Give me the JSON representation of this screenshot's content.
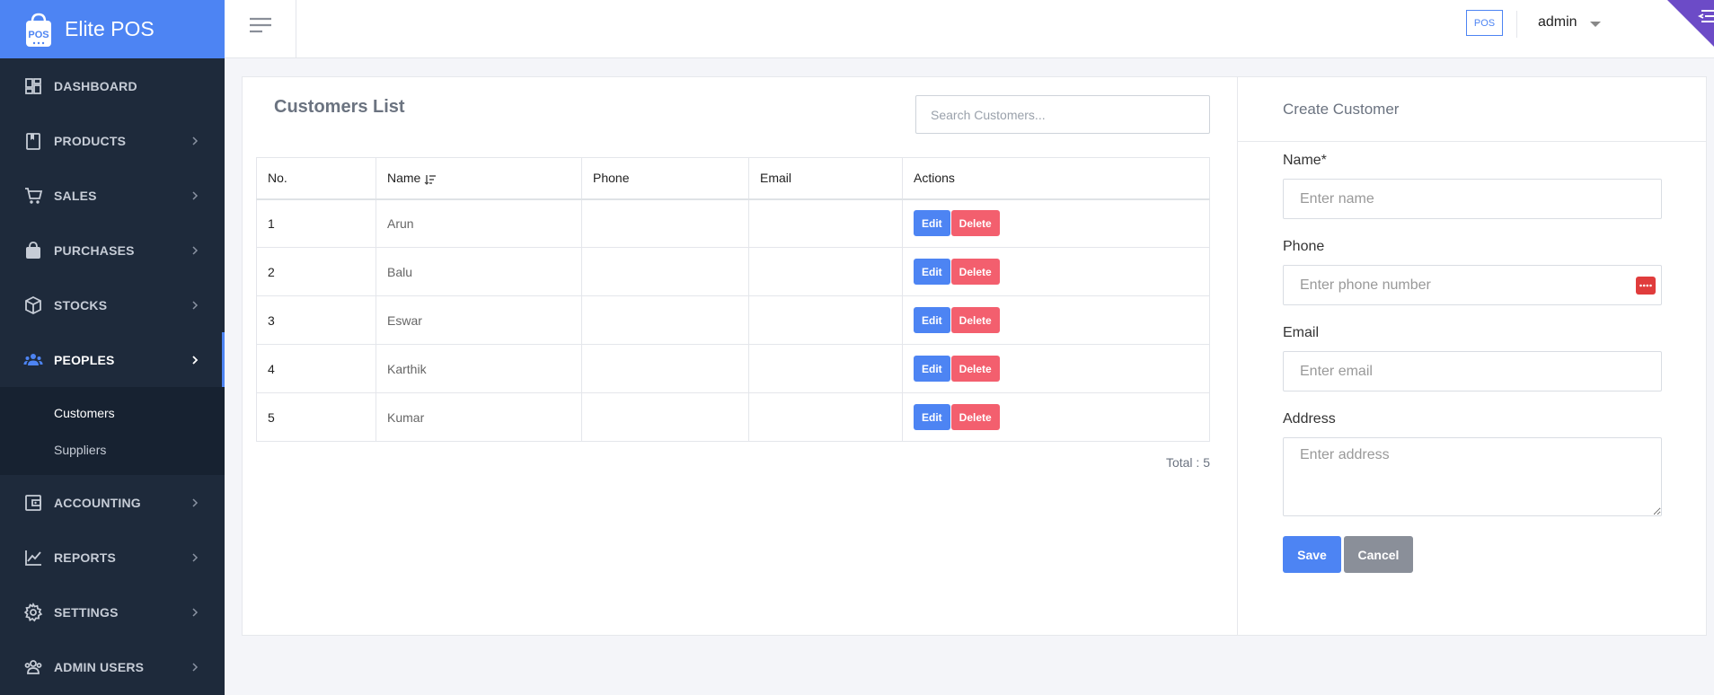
{
  "app": {
    "title": "Elite POS"
  },
  "sidebar": {
    "items": [
      {
        "label": "DASHBOARD",
        "icon": "dashboard-icon"
      },
      {
        "label": "PRODUCTS",
        "icon": "book-icon"
      },
      {
        "label": "SALES",
        "icon": "cart-icon"
      },
      {
        "label": "PURCHASES",
        "icon": "shopping-bag-icon"
      },
      {
        "label": "STOCKS",
        "icon": "box-icon"
      },
      {
        "label": "PEOPLES",
        "icon": "people-icon"
      },
      {
        "label": "ACCOUNTING",
        "icon": "wallet-icon"
      },
      {
        "label": "REPORTS",
        "icon": "chart-line-icon"
      },
      {
        "label": "SETTINGS",
        "icon": "gear-icon"
      },
      {
        "label": "ADMIN USERS",
        "icon": "admin-users-icon"
      }
    ],
    "active": "PEOPLES",
    "subitems": [
      {
        "label": "Customers"
      },
      {
        "label": "Suppliers"
      }
    ]
  },
  "topbar": {
    "pos_label": "POS",
    "user": "admin"
  },
  "customers": {
    "title": "Customers List",
    "search_placeholder": "Search Customers...",
    "columns": [
      "No.",
      "Name",
      "Phone",
      "Email",
      "Actions"
    ],
    "rows": [
      {
        "no": "1",
        "name": "Arun",
        "phone": "",
        "email": ""
      },
      {
        "no": "2",
        "name": "Balu",
        "phone": "",
        "email": ""
      },
      {
        "no": "3",
        "name": "Eswar",
        "phone": "",
        "email": ""
      },
      {
        "no": "4",
        "name": "Karthik",
        "phone": "",
        "email": ""
      },
      {
        "no": "5",
        "name": "Kumar",
        "phone": "",
        "email": ""
      }
    ],
    "edit_label": "Edit",
    "delete_label": "Delete",
    "total": "Total : 5"
  },
  "create": {
    "title": "Create Customer",
    "name_label": "Name*",
    "name_placeholder": "Enter name",
    "phone_label": "Phone",
    "phone_placeholder": "Enter phone number",
    "email_label": "Email",
    "email_placeholder": "Enter email",
    "address_label": "Address",
    "address_placeholder": "Enter address",
    "save_label": "Save",
    "cancel_label": "Cancel"
  },
  "colors": {
    "brand": "#4d84f3",
    "sidebar_bg": "#1e2a3b",
    "danger": "#f35f6e",
    "corner": "#6c4bc7"
  }
}
